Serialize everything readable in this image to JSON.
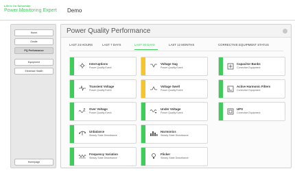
{
  "app": {
    "brand_top": "Life Is On Schneider",
    "brand_name": "Power Monitoring Expert",
    "name": "Demo"
  },
  "sidebar": {
    "items": [
      {
        "label": "Home",
        "active": false
      },
      {
        "label": "Onsite",
        "active": false
      },
      {
        "label": "PQ Performance",
        "active": true
      },
      {
        "label": "Equipment",
        "active": false
      },
      {
        "label": "Electrical Health",
        "active": false
      }
    ],
    "bottom_label": "Homepage"
  },
  "main": {
    "title": "Power Quality Performance",
    "tabs": [
      {
        "label": "LAST 24 HOURS",
        "active": false
      },
      {
        "label": "LAST 7 DAYS",
        "active": false
      },
      {
        "label": "LAST 30 DAYS",
        "active": true
      },
      {
        "label": "LAST 12 MONTHS",
        "active": false
      }
    ],
    "corrective_title": "CORRECTIVE EQUIPMENT STATUS",
    "events": [
      {
        "title": "Interruptions",
        "subtitle": "Power Quality Event",
        "status": "green",
        "icon": "interruption-icon"
      },
      {
        "title": "Voltage Sag",
        "subtitle": "Power Quality Event",
        "status": "yellow",
        "icon": "voltage-sag-icon"
      },
      {
        "title": "Transient Voltage",
        "subtitle": "Power Quality Event",
        "status": "green",
        "icon": "transient-icon"
      },
      {
        "title": "Voltage Swell",
        "subtitle": "Power Quality Event",
        "status": "yellow",
        "icon": "voltage-swell-icon"
      },
      {
        "title": "Over Voltage",
        "subtitle": "Power Quality Event",
        "status": "green",
        "icon": "over-voltage-icon"
      },
      {
        "title": "Under Voltage",
        "subtitle": "Power Quality Event",
        "status": "green",
        "icon": "under-voltage-icon"
      },
      {
        "title": "Unbalance",
        "subtitle": "Steady State Disturbance",
        "status": "green",
        "icon": "unbalance-icon"
      },
      {
        "title": "Harmonics",
        "subtitle": "Steady State Disturbance",
        "status": "green",
        "icon": "harmonics-icon"
      },
      {
        "title": "Frequency Variation",
        "subtitle": "Steady State Disturbance",
        "status": "green",
        "icon": "frequency-icon"
      },
      {
        "title": "Flicker",
        "subtitle": "Steady State Disturbance",
        "status": "green",
        "icon": "flicker-icon"
      }
    ],
    "corrective": [
      {
        "title": "Capacitor Banks",
        "subtitle": "Corrective Equipment",
        "status": "green",
        "icon": "capacitor-icon"
      },
      {
        "title": "Active Harmonic Filters",
        "subtitle": "Corrective Equipment",
        "status": "green",
        "icon": "filter-icon"
      },
      {
        "title": "UPS",
        "subtitle": "Corrective Equipment",
        "status": "green",
        "icon": "ups-icon"
      }
    ]
  },
  "colors": {
    "green": "#3dcd58",
    "yellow": "#f4c52c",
    "accent": "#3dcd58"
  }
}
